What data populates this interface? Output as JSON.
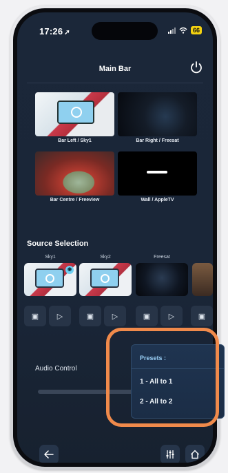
{
  "status": {
    "time": "17:26",
    "battery": "66"
  },
  "header": {
    "title": "Main Bar"
  },
  "tiles": [
    {
      "label": "Bar Left / Sky1"
    },
    {
      "label": "Bar Right / Freesat"
    },
    {
      "label": "Bar Centre / Freeview"
    },
    {
      "label": "Wall / AppleTV"
    }
  ],
  "source_selection": {
    "title": "Source Selection",
    "sources": [
      {
        "label": "Sky1"
      },
      {
        "label": "Sky2"
      },
      {
        "label": "Freesat"
      }
    ]
  },
  "audio": {
    "label": "Audio Control"
  },
  "presets": {
    "title": "Presets :",
    "items": [
      "1 - All to 1",
      "2 - All to 2"
    ]
  },
  "colors": {
    "accent": "#f08a4b",
    "background": "#1b2739"
  }
}
